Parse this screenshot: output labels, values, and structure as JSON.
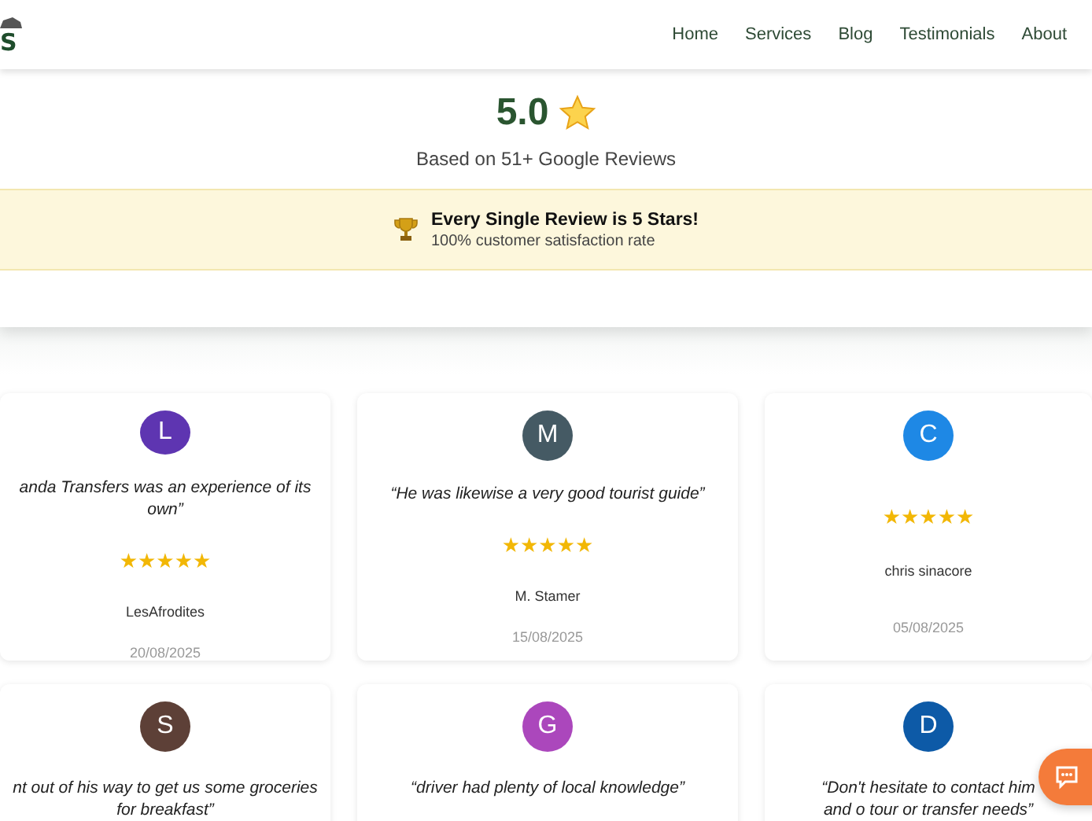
{
  "header": {
    "logo_text": "S",
    "nav": [
      {
        "label": "Home"
      },
      {
        "label": "Services"
      },
      {
        "label": "Blog"
      },
      {
        "label": "Testimonials"
      },
      {
        "label": "About"
      }
    ]
  },
  "rating": {
    "score": "5.0",
    "subtitle": "Based on 51+ Google Reviews"
  },
  "banner": {
    "title": "Every Single Review is 5 Stars!",
    "subtitle": "100% customer satisfaction rate"
  },
  "reviews": [
    {
      "initial": "L",
      "color": "#5e35b1",
      "quote": "anda Transfers was an experience of its own”",
      "stars": 5,
      "author": "LesAfrodites",
      "date": "20/08/2025"
    },
    {
      "initial": "M",
      "color": "#455a64",
      "quote": "“He was likewise a very good tourist guide”",
      "stars": 5,
      "author": "M. Stamer",
      "date": "15/08/2025"
    },
    {
      "initial": "C",
      "color": "#1e88e5",
      "stars": 5,
      "author": "chris sinacore",
      "date": "05/08/2025"
    },
    {
      "initial": "S",
      "color": "#5d4037",
      "quote": "nt out of his way to get us some groceries for breakfast”"
    },
    {
      "initial": "G",
      "color": "#ab47bc",
      "quote": "“driver had plenty of local knowledge”"
    },
    {
      "initial": "D",
      "color": "#0d5aa7",
      "quote": "“Don't hesitate to contact him and o tour or transfer needs”"
    }
  ]
}
